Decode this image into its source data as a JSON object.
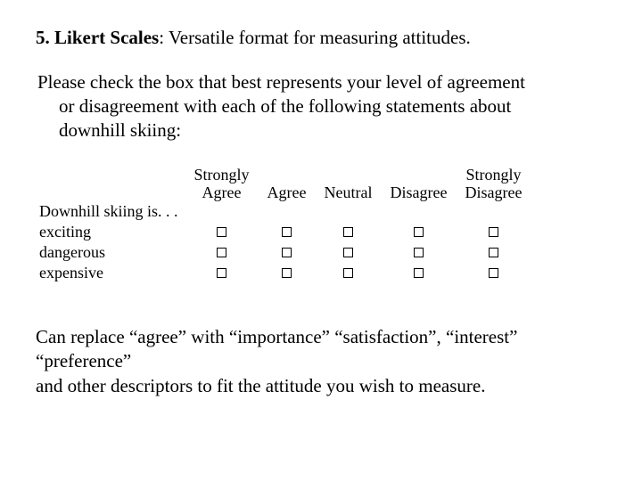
{
  "title_prefix": "5. Likert Scales",
  "title_suffix": ":  Versatile format for measuring attitudes.",
  "instructions_line1": "Please check the box that best represents your level of agreement",
  "instructions_line2": "or disagreement with each of the following statements about",
  "instructions_line3": "downhill skiing:",
  "columns": {
    "c1_top": "Strongly",
    "c1_bot": "Agree",
    "c2": "Agree",
    "c3": "Neutral",
    "c4": "Disagree",
    "c5_top": "Strongly",
    "c5_bot": "Disagree"
  },
  "row_header": "Downhill skiing is. . .",
  "rows": [
    "exciting",
    "dangerous",
    "expensive"
  ],
  "footnote_line1": "Can replace “agree” with “importance” “satisfaction”, “interest”  “preference”",
  "footnote_line2": "and other descriptors to fit the attitude you wish to measure."
}
